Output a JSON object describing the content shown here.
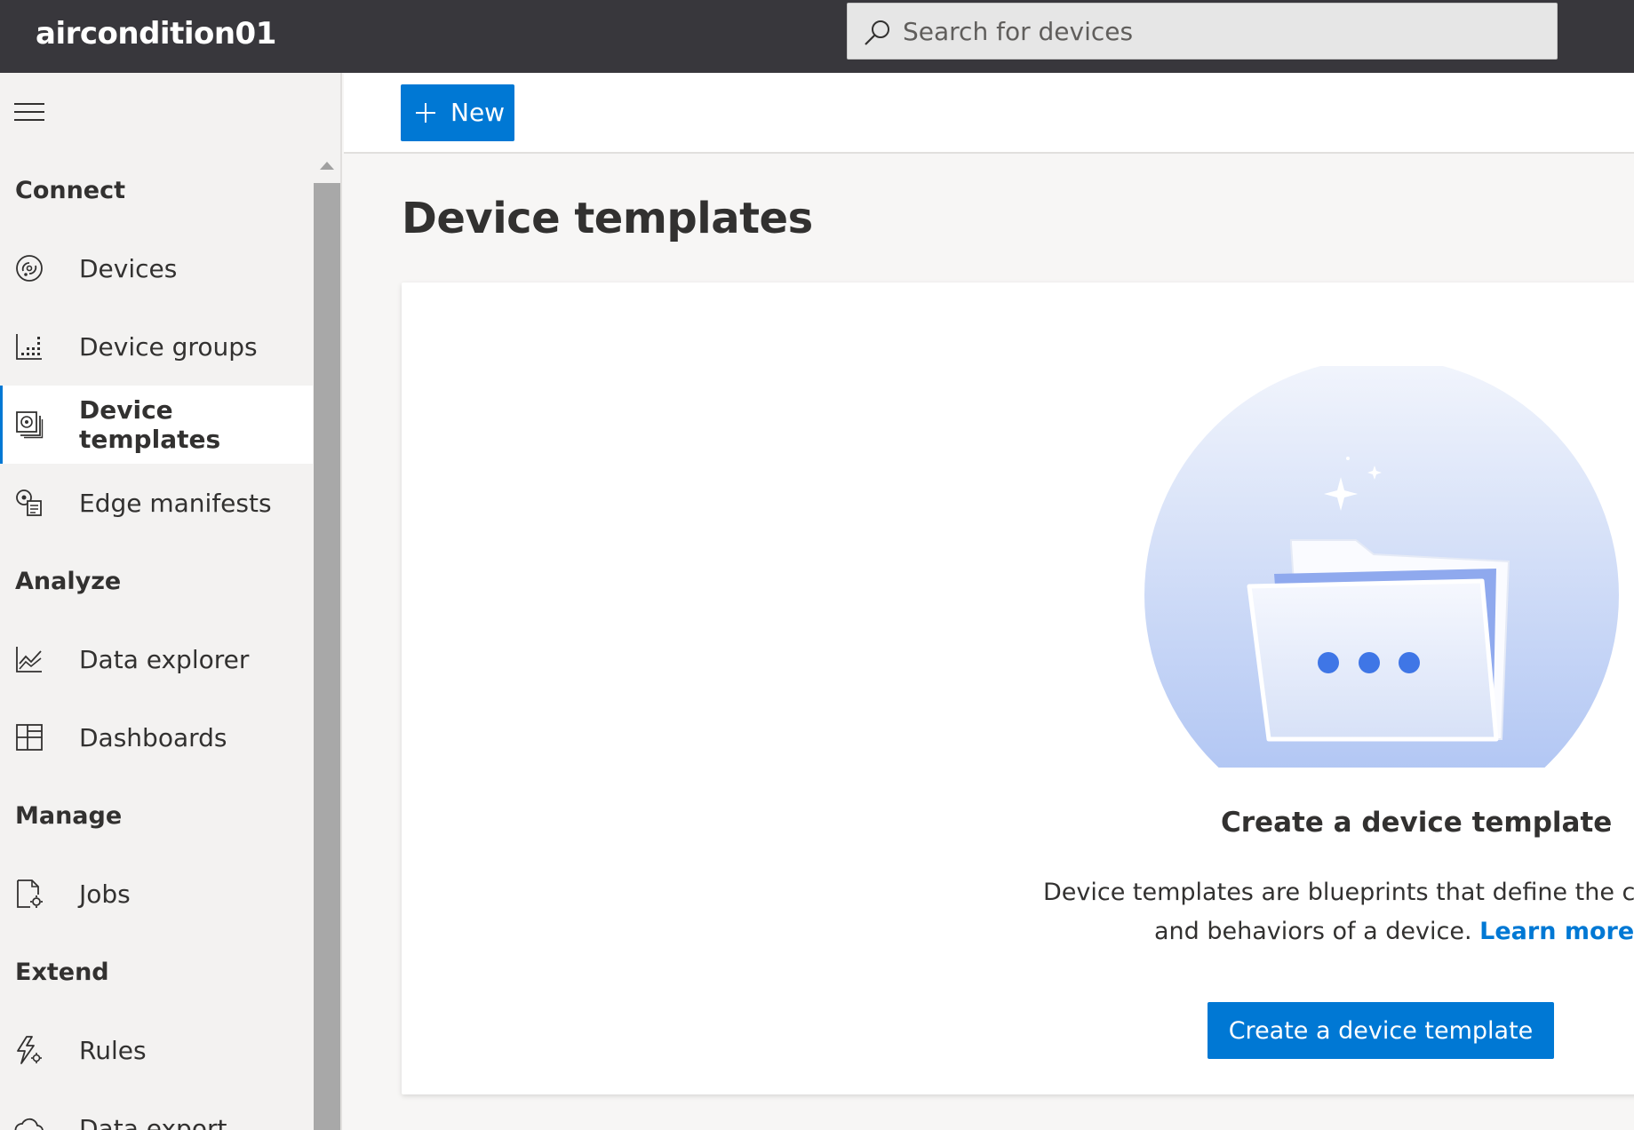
{
  "header": {
    "app_title": "aircondition01",
    "search_placeholder": "Search for devices"
  },
  "sidebar": {
    "sections": [
      {
        "title": "Connect",
        "items": [
          {
            "label": "Devices",
            "icon": "devices-icon"
          },
          {
            "label": "Device groups",
            "icon": "device-groups-icon"
          },
          {
            "label": "Device templates",
            "icon": "device-templates-icon",
            "active": true
          },
          {
            "label": "Edge manifests",
            "icon": "edge-manifests-icon"
          }
        ]
      },
      {
        "title": "Analyze",
        "items": [
          {
            "label": "Data explorer",
            "icon": "data-explorer-icon"
          },
          {
            "label": "Dashboards",
            "icon": "dashboards-icon"
          }
        ]
      },
      {
        "title": "Manage",
        "items": [
          {
            "label": "Jobs",
            "icon": "jobs-icon"
          }
        ]
      },
      {
        "title": "Extend",
        "items": [
          {
            "label": "Rules",
            "icon": "rules-icon"
          },
          {
            "label": "Data export",
            "icon": "data-export-icon"
          }
        ]
      }
    ]
  },
  "toolbar": {
    "new_label": "New"
  },
  "main": {
    "title": "Device templates",
    "empty_state": {
      "heading": "Create a device template",
      "desc_line1": "Device templates are blueprints that define the charac",
      "desc_line2": "and behaviors of a device.",
      "learn_more": "Learn more",
      "cta": "Create a device template"
    }
  },
  "colors": {
    "accent": "#0078d4",
    "topbar": "#38373c",
    "sidebar_bg": "#f3f2f1"
  }
}
